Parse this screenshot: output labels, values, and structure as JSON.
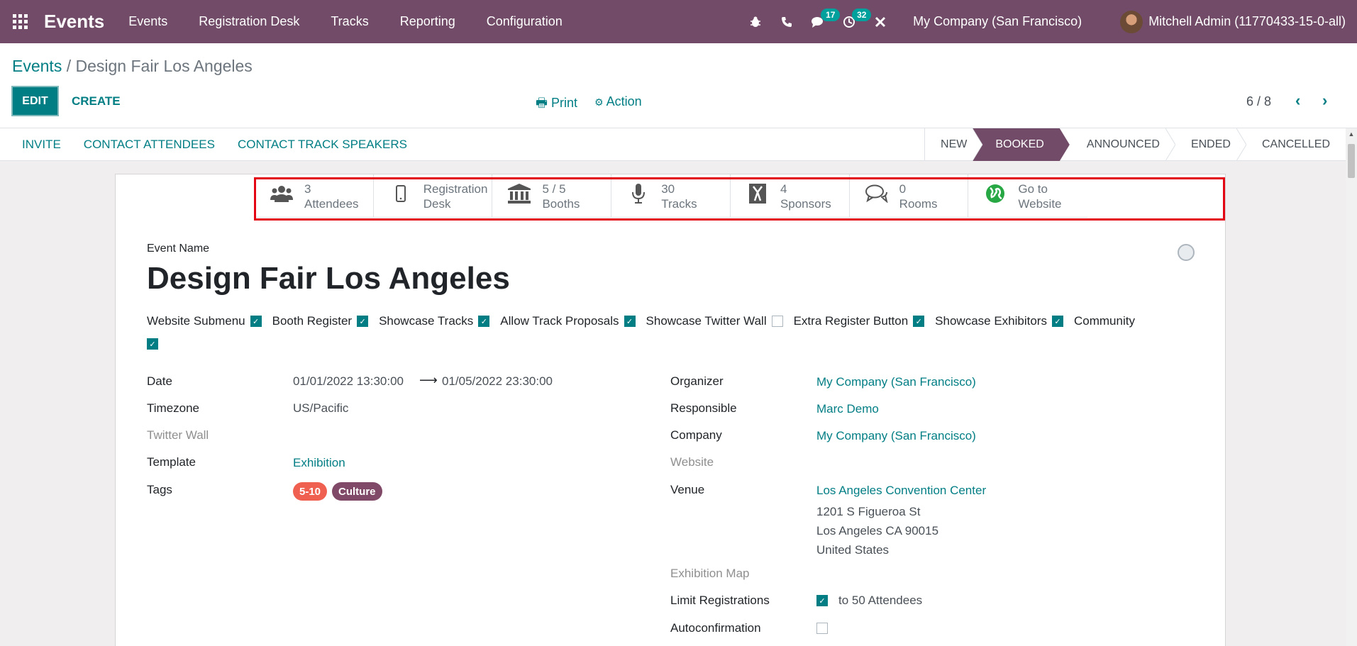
{
  "navbar": {
    "brand": "Events",
    "menu": [
      "Events",
      "Registration Desk",
      "Tracks",
      "Reporting",
      "Configuration"
    ],
    "chat_badge": "17",
    "activity_badge": "32",
    "company": "My Company (San Francisco)",
    "user": "Mitchell Admin (11770433-15-0-all)"
  },
  "breadcrumb": {
    "parent": "Events",
    "separator": "/",
    "current": "Design Fair Los Angeles"
  },
  "buttons": {
    "edit": "EDIT",
    "create": "CREATE",
    "print": "Print",
    "action": "Action"
  },
  "pager": "6 / 8",
  "header_buttons": [
    "INVITE",
    "CONTACT ATTENDEES",
    "CONTACT TRACK SPEAKERS"
  ],
  "stages": {
    "items": [
      "NEW",
      "BOOKED",
      "ANNOUNCED",
      "ENDED",
      "CANCELLED"
    ],
    "active": "BOOKED"
  },
  "smart_buttons": [
    {
      "value": "3",
      "label": "Attendees",
      "icon": "users-icon"
    },
    {
      "value": "Registration",
      "label": "Desk",
      "icon": "mobile-icon"
    },
    {
      "value": "5 / 5",
      "label": "Booths",
      "icon": "bank-icon"
    },
    {
      "value": "30",
      "label": "Tracks",
      "icon": "microphone-icon"
    },
    {
      "value": "4",
      "label": "Sponsors",
      "icon": "sponsor-icon"
    },
    {
      "value": "0",
      "label": "Rooms",
      "icon": "comments-icon"
    },
    {
      "value": "Go to",
      "label": "Website",
      "icon": "globe-icon"
    }
  ],
  "event": {
    "name_label": "Event Name",
    "name": "Design Fair Los Angeles"
  },
  "options": [
    {
      "label": "Website Submenu",
      "checked": true
    },
    {
      "label": "Booth Register",
      "checked": true
    },
    {
      "label": "Showcase Tracks",
      "checked": true
    },
    {
      "label": "Allow Track Proposals",
      "checked": true
    },
    {
      "label": "Showcase Twitter Wall",
      "checked": false
    },
    {
      "label": "Extra Register Button",
      "checked": true
    },
    {
      "label": "Showcase Exhibitors",
      "checked": true
    },
    {
      "label": "Community",
      "checked": true
    }
  ],
  "left_fields": {
    "date_label": "Date",
    "date_start": "01/01/2022 13:30:00",
    "date_end": "01/05/2022 23:30:00",
    "timezone_label": "Timezone",
    "timezone": "US/Pacific",
    "twitter_label": "Twitter Wall",
    "template_label": "Template",
    "template": "Exhibition",
    "tags_label": "Tags",
    "tags": [
      {
        "name": "5-10",
        "color": "#f06050"
      },
      {
        "name": "Culture",
        "color": "#814968"
      }
    ]
  },
  "right_fields": {
    "organizer_label": "Organizer",
    "organizer": "My Company (San Francisco)",
    "responsible_label": "Responsible",
    "responsible": "Marc Demo",
    "company_label": "Company",
    "company": "My Company (San Francisco)",
    "website_label": "Website",
    "venue_label": "Venue",
    "venue": "Los Angeles Convention Center",
    "venue_street": "1201 S Figueroa St",
    "venue_city": "Los Angeles CA 90015",
    "venue_country": "United States",
    "map_label": "Exhibition Map",
    "limit_label": "Limit Registrations",
    "limit_text": "to 50 Attendees",
    "autoconfirm_label": "Autoconfirmation"
  },
  "colors": {
    "brand": "#714b67",
    "accent": "#017e84",
    "highlight": "#e30613"
  }
}
